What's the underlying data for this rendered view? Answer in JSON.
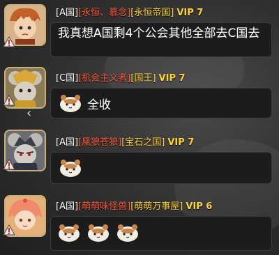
{
  "messages": [
    {
      "country": "[A国]",
      "title": "[永恒、慕念]",
      "guild": "[永恒帝国]",
      "vip": "VIP 7",
      "text": "我真想A国剩4个公会其他全部去C国去",
      "emojis": 0,
      "avatar": "warrior-avatar"
    },
    {
      "country": "[C国]",
      "title": "[机会主义者]",
      "guild": "[国王]",
      "vip": "VIP 7",
      "text": "全收",
      "emojis": 1,
      "avatar": "armored-mouse-avatar"
    },
    {
      "country": "[A国]",
      "title": "[凰狼苍狼]",
      "guild": "[宝石之国]",
      "vip": "VIP 7",
      "text": "",
      "emojis": 1,
      "avatar": "dark-mouse-avatar"
    },
    {
      "country": "[A国]",
      "title": "[萌萌味怪兽]",
      "guild": "[萌萌万事屋]",
      "vip": "VIP 6",
      "text": "",
      "emojis": 3,
      "avatar": "pink-hair-girl-avatar"
    }
  ],
  "colors": {
    "title": "#ff5a3c",
    "guild": "#ffd23c",
    "vip": "#ffd23c",
    "bubble": "#1c1c1c"
  },
  "icons": {
    "warning": "warning-icon",
    "emoji": "hamster-emoji-icon",
    "back": "chevron-left-icon"
  }
}
